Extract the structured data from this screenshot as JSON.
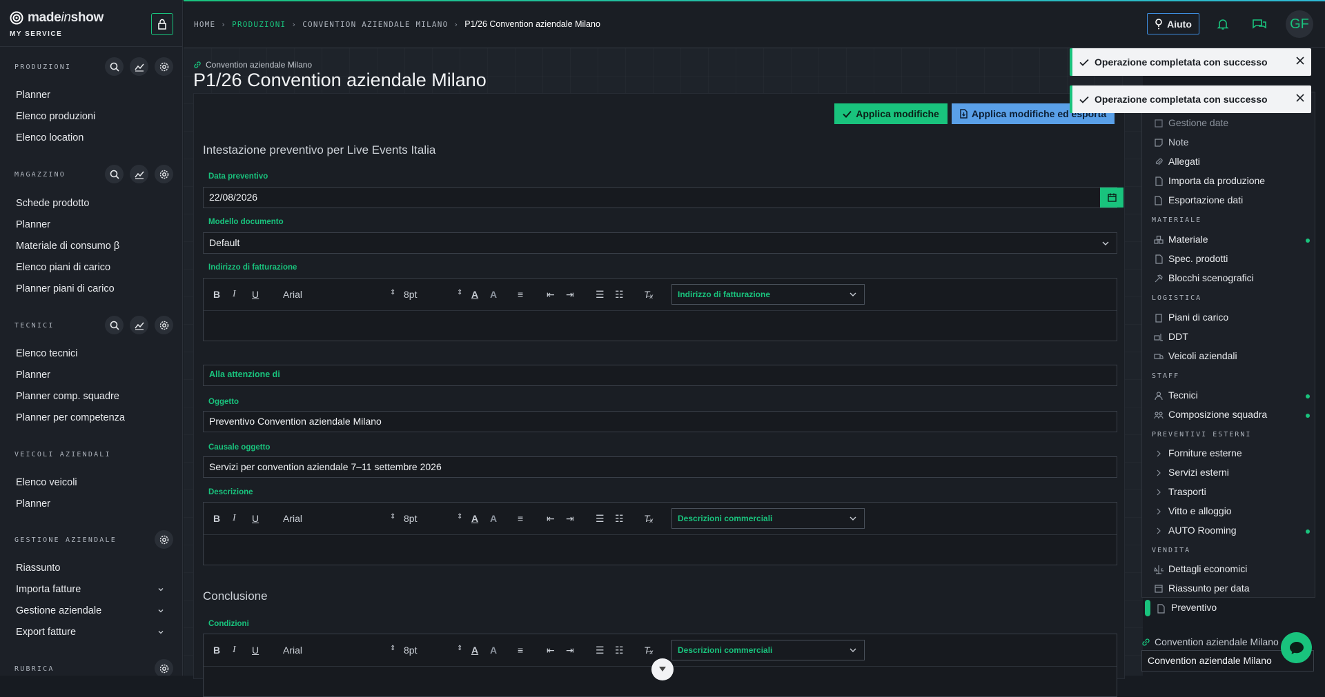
{
  "brand": {
    "name_part1": "made",
    "name_part2": "in",
    "name_part3": "show",
    "subtitle": "MY SERVICE"
  },
  "sidebar": {
    "produzioni": {
      "title": "PRODUZIONI",
      "items": [
        "Planner",
        "Elenco produzioni",
        "Elenco location"
      ]
    },
    "magazzino": {
      "title": "MAGAZZINO",
      "items": [
        "Schede prodotto",
        "Planner",
        "Materiale di consumo β",
        "Elenco piani di carico",
        "Planner piani di carico"
      ]
    },
    "tecnici": {
      "title": "TECNICI",
      "items": [
        "Elenco tecnici",
        "Planner",
        "Planner comp. squadre",
        "Planner per competenza"
      ]
    },
    "veicoli": {
      "title": "VEICOLI AZIENDALI",
      "items": [
        "Elenco veicoli",
        "Planner"
      ]
    },
    "gestione": {
      "title": "GESTIONE AZIENDALE",
      "items": [
        "Riassunto",
        "Importa fatture",
        "Gestione aziendale",
        "Export fatture"
      ]
    },
    "rubrica": {
      "title": "RUBRICA"
    }
  },
  "breadcrumb": {
    "home": "HOME",
    "produzioni": "PRODUZIONI",
    "convention": "CONVENTION AZIENDALE MILANO",
    "current": "P1/26 Convention aziendale Milano"
  },
  "header": {
    "help_label": "Aiuto",
    "avatar_initials": "GF"
  },
  "page": {
    "parent_link": "Convention aziendale Milano",
    "title": "P1/26 Convention aziendale Milano"
  },
  "actions": {
    "apply": "Applica modifiche",
    "apply_export": "Applica modifiche ed esporta"
  },
  "form": {
    "section_header": "Intestazione preventivo per Live Events Italia",
    "date_label": "Data preventivo",
    "date_value": "22/08/2026",
    "model_label": "Modello documento",
    "model_value": "Default",
    "billing_label": "Indirizzo di fatturazione",
    "billing_dd": "Indirizzo di fatturazione",
    "attention_placeholder": "Alla attenzione di",
    "subject_label": "Oggetto",
    "subject_value": "Preventivo Convention aziendale Milano",
    "cause_label": "Causale oggetto",
    "cause_value": "Servizi per convention aziendale 7–11 settembre 2026",
    "desc_label": "Descrizione",
    "desc_dd": "Descrizioni commerciali",
    "conclusion_header": "Conclusione",
    "conditions_label": "Condizioni",
    "conditions_dd": "Descrizioni commerciali",
    "toolbar": {
      "font": "Arial",
      "size": "8pt"
    }
  },
  "right_panel": {
    "top_items": [
      "Gestione date",
      "Note",
      "Allegati",
      "Importa da produzione",
      "Esportazione dati"
    ],
    "materiale": {
      "title": "MATERIALE",
      "items": [
        "Materiale",
        "Spec. prodotti",
        "Blocchi scenografici"
      ]
    },
    "logistica": {
      "title": "LOGISTICA",
      "items": [
        "Piani di carico",
        "DDT",
        "Veicoli aziendali"
      ]
    },
    "staff": {
      "title": "STAFF",
      "items": [
        "Tecnici",
        "Composizione squadra"
      ]
    },
    "esterni": {
      "title": "PREVENTIVI ESTERNI",
      "items": [
        "Forniture esterne",
        "Servizi esterni",
        "Trasporti",
        "Vitto e alloggio",
        "AUTO Rooming"
      ]
    },
    "vendita": {
      "title": "VENDITA",
      "items": [
        "Dettagli economici",
        "Riassunto per data",
        "Preventivo"
      ]
    }
  },
  "toasts": [
    "Operazione completata con successo",
    "Operazione completata con successo"
  ],
  "bottom": {
    "link": "Convention aziendale Milano",
    "field_value": "Convention aziendale Milano"
  },
  "colors": {
    "accent": "#19c37d",
    "blue": "#5aa0e8",
    "bg": "#171b21"
  }
}
